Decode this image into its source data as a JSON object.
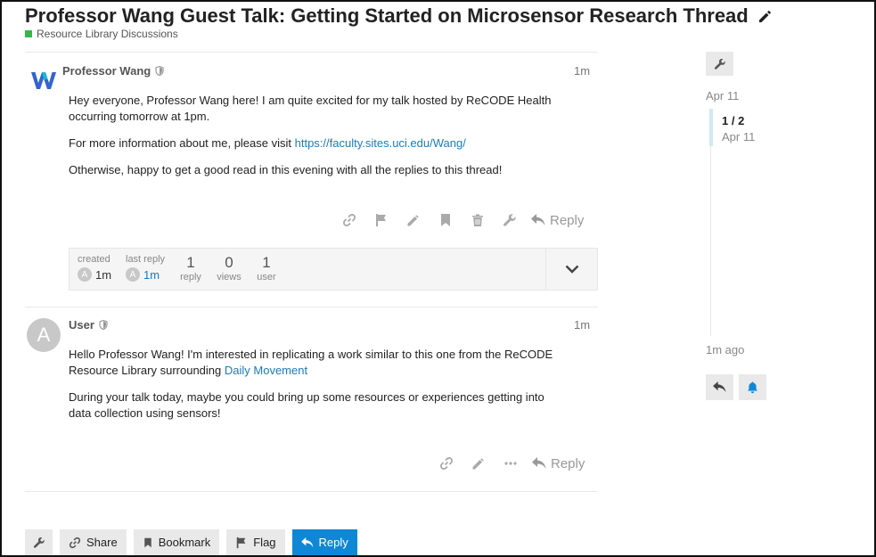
{
  "topic": {
    "title": "Professor Wang Guest Talk: Getting Started on Microsensor Research Thread",
    "category": "Resource Library Discussions",
    "category_color": "#3ab54a"
  },
  "posts": [
    {
      "username": "Professor Wang",
      "time": "1m",
      "avatar_icon": "wang-logo-icon",
      "paragraphs": [
        "Hey everyone, Professor Wang here! I am quite excited for my talk hosted by ReCODE Health occurring tomorrow at 1pm.",
        "Otherwise, happy to get a good read in this evening with all the replies to this thread!"
      ],
      "link_prefix": "For more information about me, please visit ",
      "link_text": "https://faculty.sites.uci.edu/Wang/",
      "reply_label": "Reply"
    },
    {
      "username": "User",
      "time": "1m",
      "avatar_letter": "A",
      "para1_prefix": "Hello Professor Wang! I'm interested in replicating a work similar to this one from the ReCODE Resource Library surrounding ",
      "para1_link": "Daily Movement",
      "para2": "During your talk today, maybe you could bring up some resources or experiences getting into data collection using sensors!",
      "reply_label": "Reply"
    }
  ],
  "topic_map": {
    "created_label": "created",
    "created_value": "1m",
    "last_reply_label": "last reply",
    "last_reply_value": "1m",
    "avatar_letter": "A",
    "replies_num": "1",
    "replies_label": "reply",
    "views_num": "0",
    "views_label": "views",
    "users_num": "1",
    "users_label": "user"
  },
  "timeline": {
    "start_date": "Apr 11",
    "position": "1 / 2",
    "position_date": "Apr 11",
    "end_label": "1m ago"
  },
  "footer": {
    "share": "Share",
    "bookmark": "Bookmark",
    "flag": "Flag",
    "reply": "Reply"
  },
  "colors": {
    "accent": "#0e88d6",
    "link": "#1a7bbd"
  }
}
